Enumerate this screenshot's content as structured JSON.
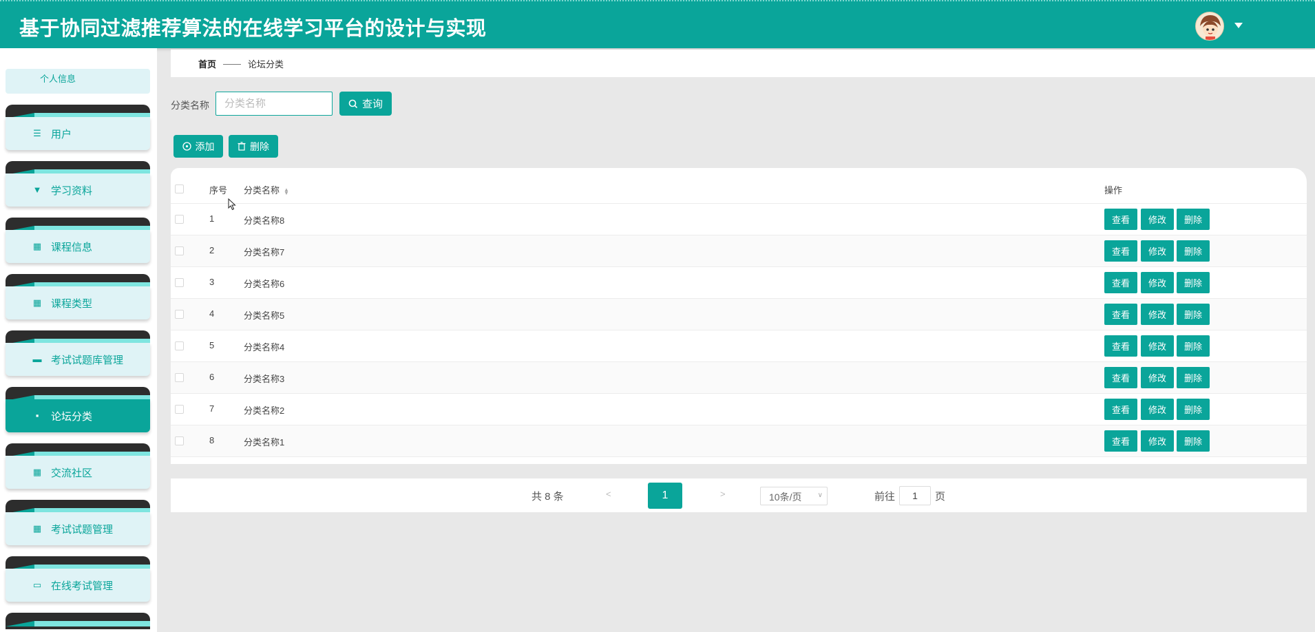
{
  "header": {
    "title": "基于协同过滤推荐算法的在线学习平台的设计与实现",
    "accent_color": "#0aa59a"
  },
  "sidebar": {
    "top_item": "个人信息",
    "items": [
      {
        "label": "用户",
        "icon": "sliders-icon"
      },
      {
        "label": "学习资料",
        "icon": "brush-icon"
      },
      {
        "label": "课程信息",
        "icon": "grid-icon"
      },
      {
        "label": "课程类型",
        "icon": "grid-icon"
      },
      {
        "label": "考试试题库管理",
        "icon": "ticket-icon"
      },
      {
        "label": "论坛分类",
        "icon": "drive-icon",
        "active": true
      },
      {
        "label": "交流社区",
        "icon": "grid-icon"
      },
      {
        "label": "考试试题管理",
        "icon": "grid-icon"
      },
      {
        "label": "在线考试管理",
        "icon": "chat-icon"
      }
    ]
  },
  "breadcrumb": {
    "home": "首页",
    "separator": "——",
    "current": "论坛分类"
  },
  "search": {
    "label": "分类名称",
    "placeholder": "分类名称",
    "button": "查询"
  },
  "actions": {
    "add": "添加",
    "delete": "删除"
  },
  "table": {
    "headers": {
      "index": "序号",
      "name": "分类名称",
      "ops": "操作"
    },
    "rows": [
      {
        "index": "1",
        "name": "分类名称8"
      },
      {
        "index": "2",
        "name": "分类名称7"
      },
      {
        "index": "3",
        "name": "分类名称6"
      },
      {
        "index": "4",
        "name": "分类名称5"
      },
      {
        "index": "5",
        "name": "分类名称4"
      },
      {
        "index": "6",
        "name": "分类名称3"
      },
      {
        "index": "7",
        "name": "分类名称2"
      },
      {
        "index": "8",
        "name": "分类名称1"
      }
    ],
    "row_buttons": {
      "view": "查看",
      "edit": "修改",
      "delete": "删除"
    }
  },
  "pagination": {
    "total": "共 8 条",
    "prev": "<",
    "current_page": "1",
    "next": ">",
    "page_size": "10条/页",
    "goto_label": "前往",
    "goto_value": "1",
    "page_unit": "页"
  }
}
